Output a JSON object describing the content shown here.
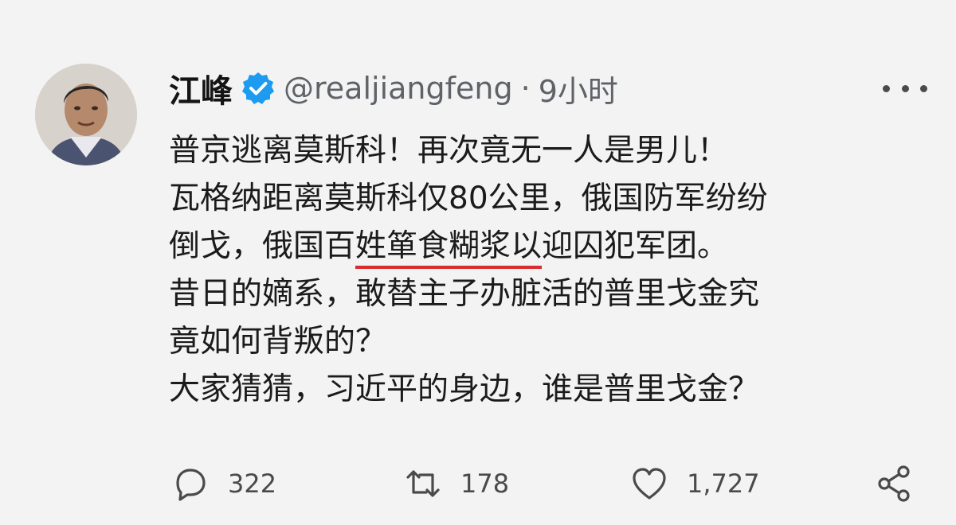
{
  "author": {
    "display_name": "江峰",
    "handle": "@realjiangfeng",
    "separator": "·",
    "time": "9小时",
    "verified": true
  },
  "tweet_lines": [
    [
      "普京逃离莫斯科！再次竟无一人是男儿！"
    ],
    [
      "瓦格纳距离莫斯科仅80公里，俄国防军纷纷"
    ],
    [
      "倒戈，俄国百",
      "姓箪食糊浆以",
      "迎囚犯军团。"
    ],
    [
      "昔日的嫡系，敢替主子办脏活的普里戈金究"
    ],
    [
      "竟如何背叛的？"
    ],
    [
      "大家猜猜，习近平的身边，谁是普里戈金？"
    ]
  ],
  "actions": {
    "replies": "322",
    "retweets": "178",
    "likes": "1,727"
  },
  "icons": {
    "verified": "verified-badge-icon",
    "more": "more-dots-icon",
    "reply": "reply-icon",
    "retweet": "retweet-icon",
    "like": "heart-icon",
    "share": "share-icon"
  },
  "colors": {
    "verified": "#1d9bf0",
    "underline": "#d92c2c",
    "background": "#f3f3f3"
  }
}
